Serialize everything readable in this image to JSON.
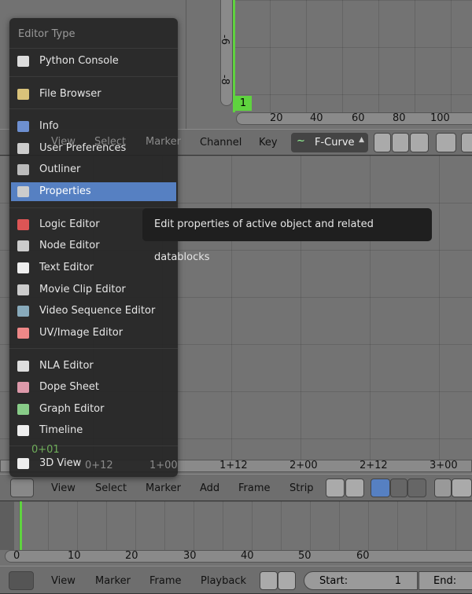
{
  "graph_editor": {
    "y_ticks": [
      "-6",
      "-8"
    ],
    "frame_indicator": "1",
    "x_ticks": [
      "20",
      "40",
      "60",
      "80",
      "100"
    ],
    "header": {
      "menus": [
        "View",
        "Select",
        "Marker",
        "Channel",
        "Key"
      ],
      "mode_dropdown": "F-Curve"
    }
  },
  "sequencer": {
    "time_ticks": [
      "0+01",
      "0+12",
      "1+00",
      "1+12",
      "2+00",
      "2+12",
      "3+00"
    ],
    "header": {
      "menus": [
        "View",
        "Select",
        "Marker",
        "Add",
        "Frame",
        "Strip"
      ]
    }
  },
  "timeline": {
    "ticks": [
      "0",
      "10",
      "20",
      "30",
      "40",
      "50",
      "60"
    ],
    "header": {
      "menus": [
        "View",
        "Marker",
        "Frame",
        "Playback"
      ],
      "start_label": "Start:",
      "start_value": "1",
      "end_label": "End:"
    }
  },
  "menu": {
    "title": "Editor Type",
    "items": [
      {
        "label": "Python Console",
        "icon": "console-icon"
      },
      {
        "label": "File Browser",
        "icon": "folder-icon"
      },
      {
        "label": "Info",
        "icon": "info-icon"
      },
      {
        "label": "User Preferences",
        "icon": "preferences-icon"
      },
      {
        "label": "Outliner",
        "icon": "outliner-icon"
      },
      {
        "label": "Properties",
        "icon": "properties-icon",
        "highlighted": true
      },
      {
        "label": "Logic Editor",
        "icon": "logic-icon"
      },
      {
        "label": "Node Editor",
        "icon": "node-icon"
      },
      {
        "label": "Text Editor",
        "icon": "text-icon"
      },
      {
        "label": "Movie Clip Editor",
        "icon": "clip-icon"
      },
      {
        "label": "Video Sequence Editor",
        "icon": "sequence-icon"
      },
      {
        "label": "UV/Image Editor",
        "icon": "image-icon"
      },
      {
        "label": "NLA Editor",
        "icon": "nla-icon"
      },
      {
        "label": "Dope Sheet",
        "icon": "dopesheet-icon"
      },
      {
        "label": "Graph Editor",
        "icon": "graph-icon"
      },
      {
        "label": "Timeline",
        "icon": "timeline-icon"
      },
      {
        "label": "3D View",
        "icon": "cube-icon"
      }
    ]
  },
  "tooltip": "Edit properties of active object and related datablocks",
  "colors": {
    "highlight": "#5680c2",
    "playhead": "#5fd33f",
    "menu_bg": "#252525"
  }
}
